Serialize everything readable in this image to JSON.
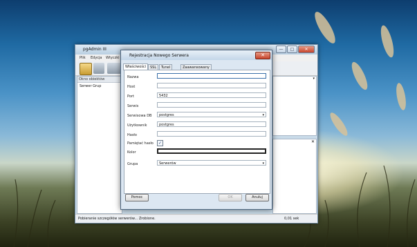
{
  "main_window": {
    "title": "pgAdmin III",
    "menu": [
      "Plik",
      "Edycja",
      "Wtyczki"
    ],
    "browser_header": "Okno obiektów",
    "tree_node": "Serwer Grup",
    "status_left": "Pobieranie szczegółów serwerów... Zrobione.",
    "status_right": "0,01 sek"
  },
  "dialog": {
    "title": "Rejestracja Nowego Serwera",
    "close_symbol": "✕",
    "tabs": [
      "Właściwości",
      "SSL",
      "Tunel SSH",
      "Zaawansowany"
    ],
    "fields": {
      "name": {
        "label": "Nazwa",
        "value": ""
      },
      "host": {
        "label": "Host",
        "value": ""
      },
      "port": {
        "label": "Port",
        "value": "5432"
      },
      "service": {
        "label": "Serwis",
        "value": ""
      },
      "maintenance_db": {
        "label": "Serwisowa DB",
        "value": "postgres"
      },
      "username": {
        "label": "Użytkownik",
        "value": "postgres"
      },
      "password": {
        "label": "Hasło",
        "value": ""
      },
      "remember_password": {
        "label": "Pamiętać hasło",
        "checked": true,
        "check_symbol": "✓"
      },
      "color": {
        "label": "Kolor",
        "value": ""
      },
      "group": {
        "label": "Grupa",
        "value": "Serwerów"
      }
    },
    "buttons": {
      "help": "Pomoc",
      "ok": "OK",
      "cancel": "Anuluj"
    }
  },
  "icons": {
    "dropdown_arrow": "▾",
    "minimize": "—",
    "maximize": "□",
    "close": "✕"
  },
  "colors": {
    "accent_close": "#c6442c",
    "window_frame": "#c9dbe9"
  }
}
